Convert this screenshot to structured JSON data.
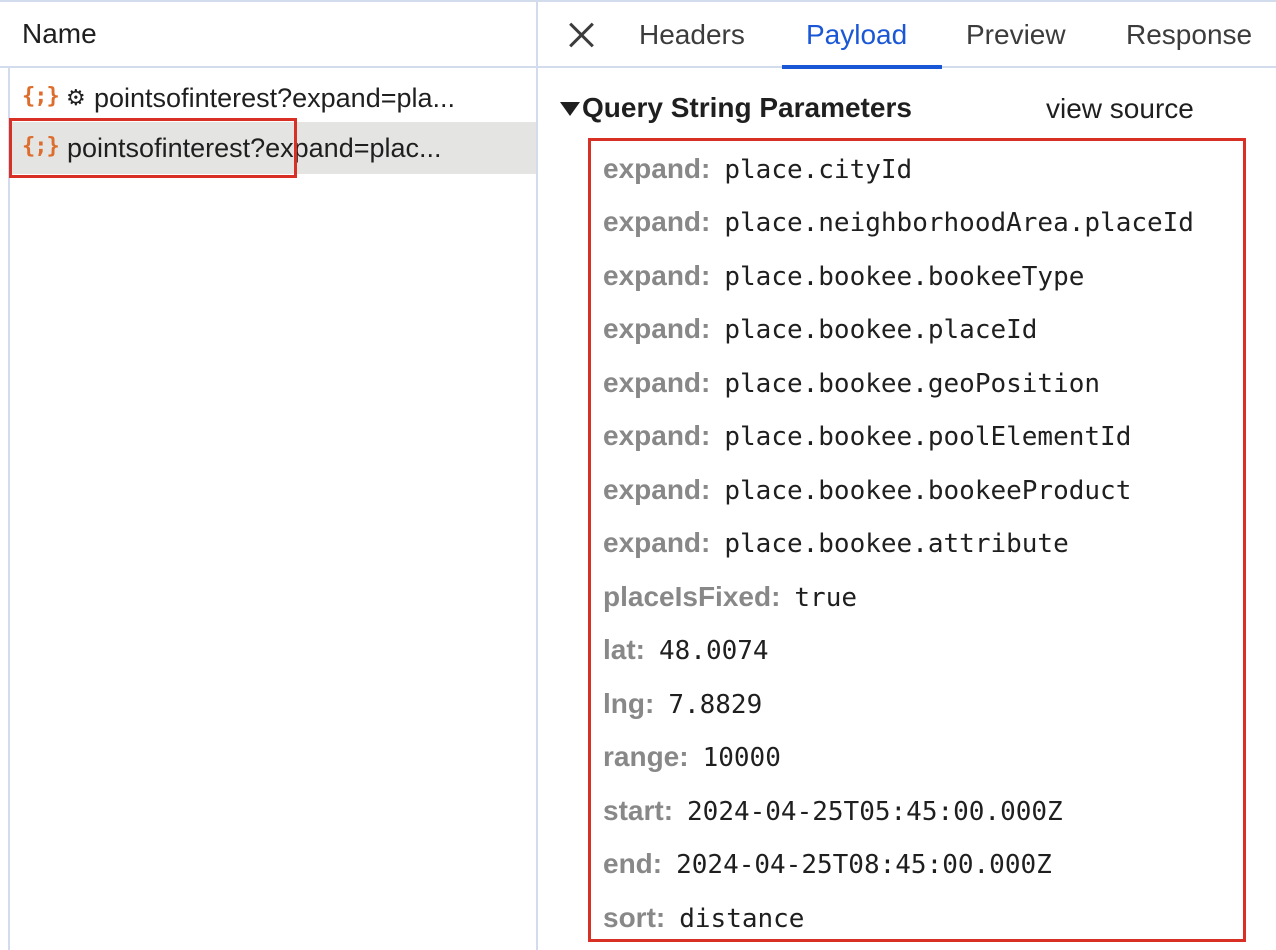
{
  "left": {
    "header_title": "Name",
    "rows": [
      {
        "icon": "fetch-icon",
        "icon_text": "{;}",
        "gear": "⚙",
        "label": "pointsofinterest?expand=pla..."
      },
      {
        "icon": "fetch-icon",
        "icon_text": "{;}",
        "label": "pointsofinterest?expand=plac..."
      }
    ]
  },
  "tabs": {
    "headers": "Headers",
    "payload": "Payload",
    "preview": "Preview",
    "response": "Response",
    "active": "Payload"
  },
  "payload": {
    "section_title": "Query String Parameters",
    "view_source": "view source",
    "params": [
      {
        "key": "expand:",
        "value": "place.cityId"
      },
      {
        "key": "expand:",
        "value": "place.neighborhoodArea.placeId"
      },
      {
        "key": "expand:",
        "value": "place.bookee.bookeeType"
      },
      {
        "key": "expand:",
        "value": "place.bookee.placeId"
      },
      {
        "key": "expand:",
        "value": "place.bookee.geoPosition"
      },
      {
        "key": "expand:",
        "value": "place.bookee.poolElementId"
      },
      {
        "key": "expand:",
        "value": "place.bookee.bookeeProduct"
      },
      {
        "key": "expand:",
        "value": "place.bookee.attribute"
      },
      {
        "key": "placeIsFixed:",
        "value": "true"
      },
      {
        "key": "lat:",
        "value": "48.0074"
      },
      {
        "key": "lng:",
        "value": "7.8829"
      },
      {
        "key": "range:",
        "value": "10000"
      },
      {
        "key": "start:",
        "value": "2024-04-25T05:45:00.000Z"
      },
      {
        "key": "end:",
        "value": "2024-04-25T08:45:00.000Z"
      },
      {
        "key": "sort:",
        "value": "distance"
      }
    ]
  },
  "colors": {
    "accent": "#1a57d6",
    "highlight": "#d93025",
    "fetch_icon": "#dd6d2c",
    "key_text": "#888888"
  }
}
